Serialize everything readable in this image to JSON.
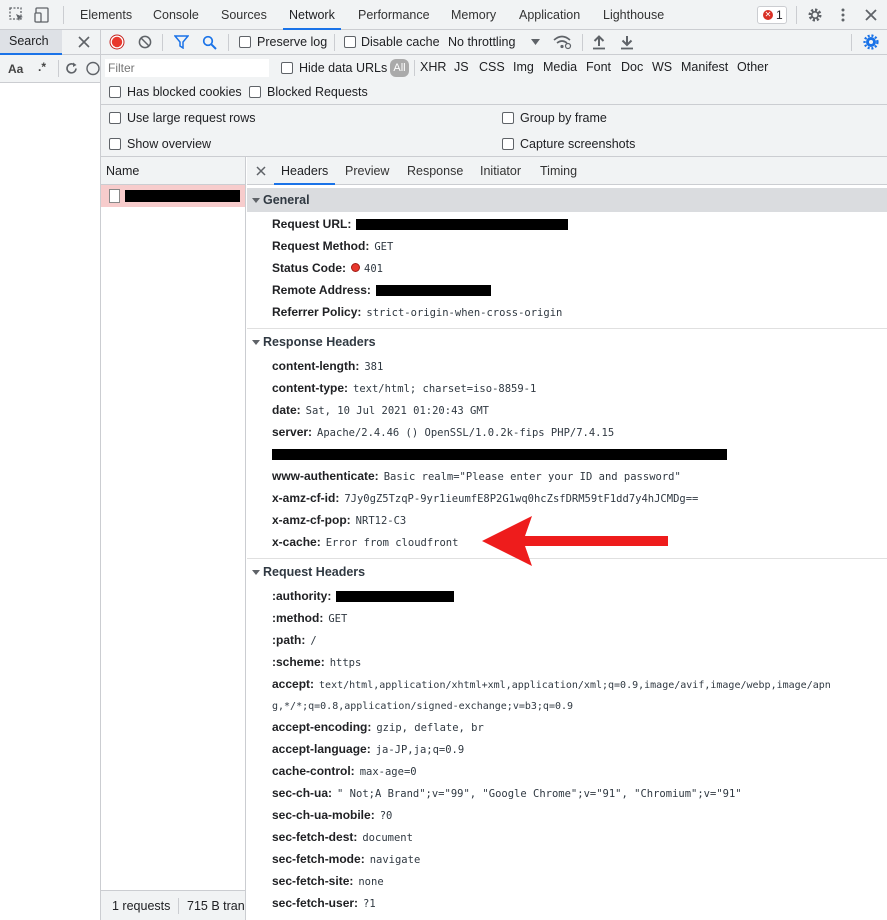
{
  "top_tabs": [
    "Elements",
    "Console",
    "Sources",
    "Network",
    "Performance",
    "Memory",
    "Application",
    "Lighthouse"
  ],
  "error_count": "1",
  "search": {
    "tab_label": "Search",
    "case_label": "Aa",
    "regex_label": ".*"
  },
  "toolbar": {
    "preserve_log": "Preserve log",
    "disable_cache": "Disable cache",
    "throttling": "No throttling"
  },
  "filter": {
    "placeholder": "Filter",
    "hide_data_urls": "Hide data URLs",
    "all": "All",
    "types": [
      "XHR",
      "JS",
      "CSS",
      "Img",
      "Media",
      "Font",
      "Doc",
      "WS",
      "Manifest",
      "Other"
    ],
    "has_blocked_cookies": "Has blocked cookies",
    "blocked_requests": "Blocked Requests"
  },
  "settings": {
    "large_rows": "Use large request rows",
    "show_overview": "Show overview",
    "group_by_frame": "Group by frame",
    "capture_screenshots": "Capture screenshots"
  },
  "name_column": {
    "header": "Name",
    "requests": "1 requests",
    "transferred": "715 B tran"
  },
  "detail_tabs": [
    "Headers",
    "Preview",
    "Response",
    "Initiator",
    "Timing"
  ],
  "general": {
    "title": "General",
    "request_url_label": "Request URL:",
    "request_method_label": "Request Method:",
    "request_method": "GET",
    "status_code_label": "Status Code:",
    "status_code": "401",
    "remote_address_label": "Remote Address:",
    "referrer_policy_label": "Referrer Policy:",
    "referrer_policy": "strict-origin-when-cross-origin"
  },
  "response_headers": {
    "title": "Response Headers",
    "rows": [
      {
        "name": "content-length:",
        "value": "381"
      },
      {
        "name": "content-type:",
        "value": "text/html; charset=iso-8859-1"
      },
      {
        "name": "date:",
        "value": "Sat, 10 Jul 2021 01:20:43 GMT"
      },
      {
        "name": "server:",
        "value": "Apache/2.4.46 () OpenSSL/1.0.2k-fips PHP/7.4.15"
      },
      {
        "name": "",
        "value": ""
      },
      {
        "name": "www-authenticate:",
        "value": "Basic realm=\"Please enter your ID and password\""
      },
      {
        "name": "x-amz-cf-id:",
        "value": "7Jy0gZ5TzqP-9yr1ieumfE8P2G1wq0hcZsfDRM59tF1dd7y4hJCMDg=="
      },
      {
        "name": "x-amz-cf-pop:",
        "value": "NRT12-C3"
      },
      {
        "name": "x-cache:",
        "value": "Error from cloudfront"
      }
    ]
  },
  "request_headers": {
    "title": "Request Headers",
    "rows": [
      {
        "name": ":authority:",
        "value": ""
      },
      {
        "name": ":method:",
        "value": "GET"
      },
      {
        "name": ":path:",
        "value": "/"
      },
      {
        "name": ":scheme:",
        "value": "https"
      },
      {
        "name": "accept:",
        "value": "text/html,application/xhtml+xml,application/xml;q=0.9,image/avif,image/webp,image/apn"
      },
      {
        "name": "",
        "value": "g,*/*;q=0.8,application/signed-exchange;v=b3;q=0.9"
      },
      {
        "name": "accept-encoding:",
        "value": "gzip, deflate, br"
      },
      {
        "name": "accept-language:",
        "value": "ja-JP,ja;q=0.9"
      },
      {
        "name": "cache-control:",
        "value": "max-age=0"
      },
      {
        "name": "sec-ch-ua:",
        "value": "\" Not;A Brand\";v=\"99\", \"Google Chrome\";v=\"91\", \"Chromium\";v=\"91\""
      },
      {
        "name": "sec-ch-ua-mobile:",
        "value": "?0"
      },
      {
        "name": "sec-fetch-dest:",
        "value": "document"
      },
      {
        "name": "sec-fetch-mode:",
        "value": "navigate"
      },
      {
        "name": "sec-fetch-site:",
        "value": "none"
      },
      {
        "name": "sec-fetch-user:",
        "value": "?1"
      }
    ]
  },
  "colors": {
    "accent": "#1a73e8",
    "error": "#d93025",
    "selected_row": "#f7cccc",
    "arrow": "#ee1c1c"
  }
}
